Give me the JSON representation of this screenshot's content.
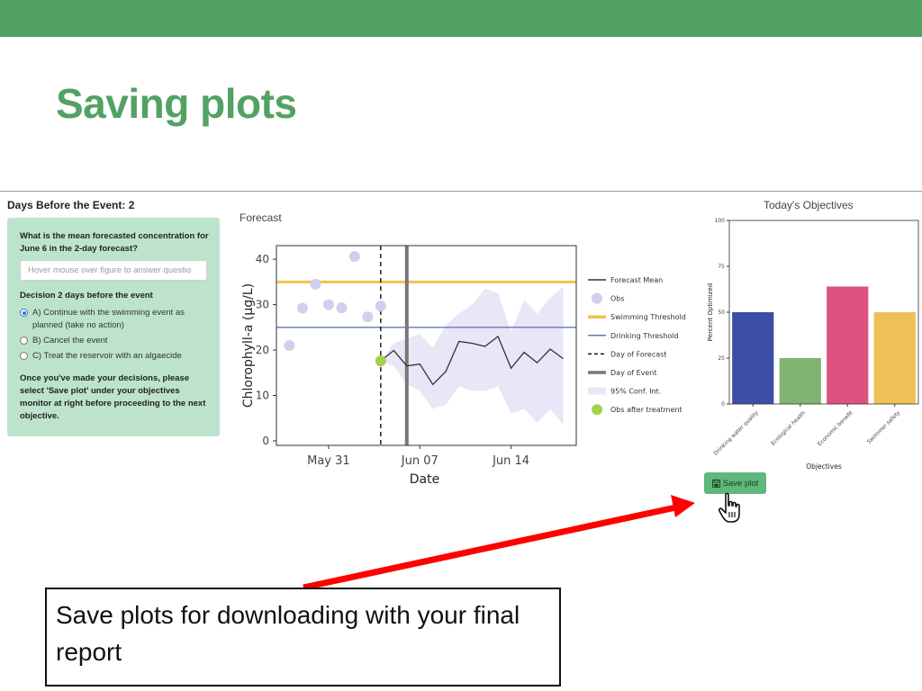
{
  "slide": {
    "title": "Saving plots",
    "callout": "Save plots for downloading with your final report",
    "accent_color": "#53a264",
    "arrow_color": "#ff0000"
  },
  "app": {
    "days_title": "Days Before the Event: 2",
    "question": "What is the mean forecasted concentration for June 6 in the 2-day forecast?",
    "input_placeholder": "Hover mouse over figure to answer questio",
    "decision_label": "Decision 2 days before the event",
    "options": [
      {
        "label": "A) Continue with the swimming event as planned (take no action)",
        "selected": true
      },
      {
        "label": "B) Cancel the event",
        "selected": false
      },
      {
        "label": "C) Treat the reservoir with an algaecide",
        "selected": false
      }
    ],
    "instructions": "Once you've made your decisions, please select 'Save plot' under your objectives monitor at right before proceeding to the next objective.",
    "save_button_label": "Save plot",
    "save_icon": "floppy-disk-icon",
    "cursor_icon": "hand-pointer-icon"
  },
  "chart_data": [
    {
      "type": "line",
      "title": "Forecast",
      "xlabel": "Date",
      "ylabel": "Chlorophyll-a (μg/L)",
      "ylim": [
        -1,
        43
      ],
      "yticks": [
        0,
        10,
        20,
        30,
        40
      ],
      "xlim": [
        "2021-05-27",
        "2021-06-19"
      ],
      "xticks": [
        {
          "date": "2021-05-31",
          "label": "May 31"
        },
        {
          "date": "2021-06-07",
          "label": "Jun 07"
        },
        {
          "date": "2021-06-14",
          "label": "Jun 14"
        }
      ],
      "grid": false,
      "legend_position": "right",
      "swimming_threshold": 35,
      "drinking_threshold": 25,
      "day_of_forecast": "2021-06-04",
      "day_of_event": "2021-06-06",
      "obs": [
        {
          "x": "2021-05-28",
          "y": 21
        },
        {
          "x": "2021-05-29",
          "y": 29.2
        },
        {
          "x": "2021-05-30",
          "y": 34.5
        },
        {
          "x": "2021-05-31",
          "y": 30
        },
        {
          "x": "2021-06-01",
          "y": 29.3
        },
        {
          "x": "2021-06-02",
          "y": 40.6
        },
        {
          "x": "2021-06-03",
          "y": 27.3
        },
        {
          "x": "2021-06-04",
          "y": 29.7
        }
      ],
      "obs_after_treatment": [
        {
          "x": "2021-06-04",
          "y": 17.6
        }
      ],
      "forecast_mean": [
        {
          "x": "2021-06-04",
          "y": 17.6
        },
        {
          "x": "2021-06-05",
          "y": 19.9
        },
        {
          "x": "2021-06-06",
          "y": 16.5
        },
        {
          "x": "2021-06-07",
          "y": 16.9
        },
        {
          "x": "2021-06-08",
          "y": 12.4
        },
        {
          "x": "2021-06-09",
          "y": 15.3
        },
        {
          "x": "2021-06-10",
          "y": 21.9
        },
        {
          "x": "2021-06-11",
          "y": 21.5
        },
        {
          "x": "2021-06-12",
          "y": 20.8
        },
        {
          "x": "2021-06-13",
          "y": 23
        },
        {
          "x": "2021-06-14",
          "y": 16
        },
        {
          "x": "2021-06-15",
          "y": 19.5
        },
        {
          "x": "2021-06-16",
          "y": 17.2
        },
        {
          "x": "2021-06-17",
          "y": 20.2
        },
        {
          "x": "2021-06-18",
          "y": 18.1
        }
      ],
      "ci_95": [
        {
          "x": "2021-06-04",
          "lo": 17.6,
          "hi": 17.6
        },
        {
          "x": "2021-06-05",
          "lo": 16.5,
          "hi": 21.5
        },
        {
          "x": "2021-06-06",
          "lo": 12.5,
          "hi": 22.5
        },
        {
          "x": "2021-06-07",
          "lo": 11,
          "hi": 23.5
        },
        {
          "x": "2021-06-08",
          "lo": 7,
          "hi": 20.5
        },
        {
          "x": "2021-06-09",
          "lo": 8,
          "hi": 25.5
        },
        {
          "x": "2021-06-10",
          "lo": 12,
          "hi": 28
        },
        {
          "x": "2021-06-11",
          "lo": 11,
          "hi": 30
        },
        {
          "x": "2021-06-12",
          "lo": 11,
          "hi": 33.5
        },
        {
          "x": "2021-06-13",
          "lo": 12,
          "hi": 32.5
        },
        {
          "x": "2021-06-14",
          "lo": 6,
          "hi": 24
        },
        {
          "x": "2021-06-15",
          "lo": 7,
          "hi": 31
        },
        {
          "x": "2021-06-16",
          "lo": 4,
          "hi": 28
        },
        {
          "x": "2021-06-17",
          "lo": 7,
          "hi": 31.5
        },
        {
          "x": "2021-06-18",
          "lo": 3.5,
          "hi": 34
        }
      ],
      "legend": [
        {
          "label": "Forecast Mean",
          "style": "line",
          "color": "#333333"
        },
        {
          "label": "Obs",
          "style": "circle",
          "color": "#cfcfee"
        },
        {
          "label": "Swimming Threshold",
          "style": "thick-line",
          "color": "#f0c24e"
        },
        {
          "label": "Drinking Threshold",
          "style": "line",
          "color": "#6278b5"
        },
        {
          "label": "Day of Forecast",
          "style": "dashed-line",
          "color": "#111111"
        },
        {
          "label": "Day of Event",
          "style": "thick-line",
          "color": "#777777"
        },
        {
          "label": "95% Conf. Int.",
          "style": "fill",
          "color": "#e9e6f8"
        },
        {
          "label": "Obs after treatment",
          "style": "circle",
          "color": "#a4d14a"
        }
      ]
    },
    {
      "type": "bar",
      "title": "Today's Objectives",
      "xlabel": "Objectives",
      "ylabel": "Percent Optimized",
      "ylim": [
        0,
        100
      ],
      "yticks": [
        0,
        25,
        50,
        75,
        100
      ],
      "grid": false,
      "categories": [
        "Drinking water quality",
        "Ecological health",
        "Economic benefit",
        "Swimmer safety"
      ],
      "values": [
        50,
        25,
        64,
        50
      ],
      "colors": [
        "#3c4ea6",
        "#80b372",
        "#dc527e",
        "#eec055"
      ]
    }
  ]
}
